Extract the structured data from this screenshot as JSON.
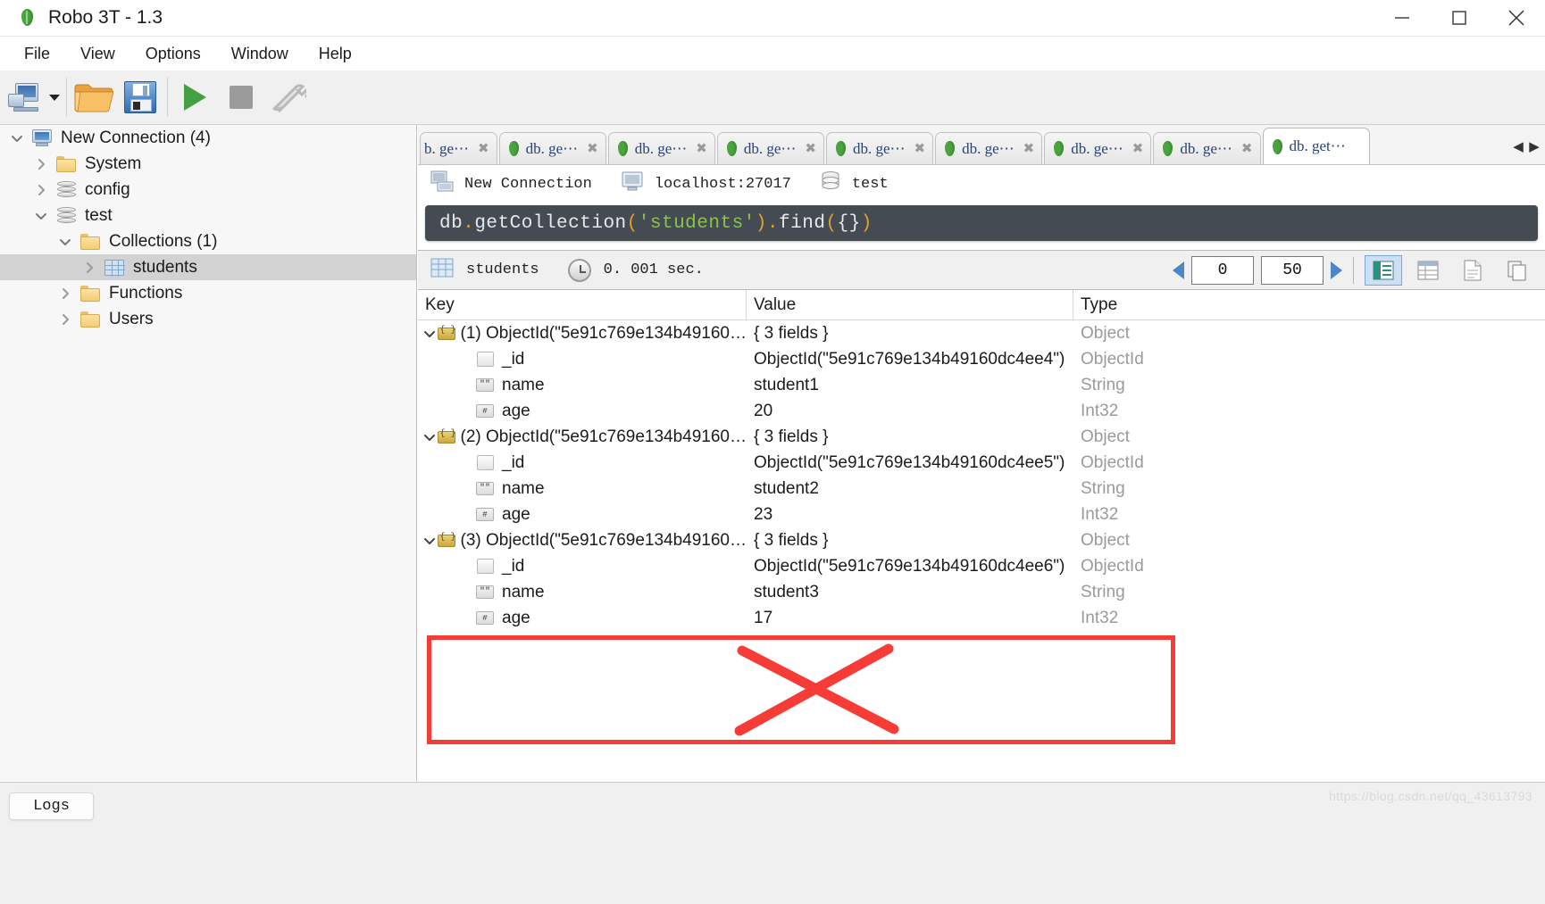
{
  "window": {
    "title": "Robo 3T - 1.3",
    "app_icon": "mongodb-leaf-icon",
    "controls": {
      "minimize": "minimize-icon",
      "maximize": "maximize-icon",
      "close": "close-icon"
    }
  },
  "menubar": {
    "items": [
      {
        "label": "File"
      },
      {
        "label": "View"
      },
      {
        "label": "Options"
      },
      {
        "label": "Window"
      },
      {
        "label": "Help"
      }
    ]
  },
  "toolbar": {
    "buttons": [
      {
        "name": "connect-button",
        "icon": "computer-connect-icon"
      },
      {
        "name": "connect-dropdown",
        "icon": "chevron-down-icon"
      },
      {
        "name": "open-script-button",
        "icon": "folder-open-icon"
      },
      {
        "name": "save-script-button",
        "icon": "floppy-save-icon"
      },
      {
        "name": "execute-button",
        "icon": "play-icon"
      },
      {
        "name": "stop-button",
        "icon": "stop-icon"
      },
      {
        "name": "explain-button",
        "icon": "wrench-icon"
      }
    ]
  },
  "sidebar": {
    "tree": [
      {
        "label": "New Connection (4)",
        "icon": "computer-icon",
        "depth": 0,
        "expanded": true,
        "has_twisty": true,
        "selected": false
      },
      {
        "label": "System",
        "icon": "folder-icon",
        "depth": 1,
        "expanded": false,
        "has_twisty": true,
        "selected": false
      },
      {
        "label": "config",
        "icon": "database-icon",
        "depth": 1,
        "expanded": false,
        "has_twisty": true,
        "selected": false
      },
      {
        "label": "test",
        "icon": "database-icon",
        "depth": 1,
        "expanded": true,
        "has_twisty": true,
        "selected": false
      },
      {
        "label": "Collections (1)",
        "icon": "folder-icon",
        "depth": 2,
        "expanded": true,
        "has_twisty": true,
        "selected": false
      },
      {
        "label": "students",
        "icon": "collection-grid-icon",
        "depth": 3,
        "expanded": false,
        "has_twisty": true,
        "selected": true
      },
      {
        "label": "Functions",
        "icon": "folder-icon",
        "depth": 2,
        "expanded": false,
        "has_twisty": true,
        "selected": false
      },
      {
        "label": "Users",
        "icon": "folder-icon",
        "depth": 2,
        "expanded": false,
        "has_twisty": true,
        "selected": false
      }
    ]
  },
  "tabs": {
    "items": [
      {
        "label": "b. ge⋯",
        "active": false,
        "partial": true
      },
      {
        "label": "db. ge⋯",
        "active": false,
        "partial": false
      },
      {
        "label": "db. ge⋯",
        "active": false,
        "partial": false
      },
      {
        "label": "db. ge⋯",
        "active": false,
        "partial": false
      },
      {
        "label": "db. ge⋯",
        "active": false,
        "partial": false
      },
      {
        "label": "db. ge⋯",
        "active": false,
        "partial": false
      },
      {
        "label": "db. ge⋯",
        "active": false,
        "partial": false
      },
      {
        "label": "db. ge⋯",
        "active": false,
        "partial": false
      },
      {
        "label": "db. get⋯",
        "active": true,
        "partial": false
      }
    ],
    "close_glyph": "✖",
    "nav_prev": "◀",
    "nav_next": "▶"
  },
  "connection_bar": {
    "connection_name": "New Connection",
    "host": "localhost:27017",
    "database": "test",
    "icons": {
      "connection": "server-icon",
      "host": "monitor-icon",
      "database": "database-icon"
    }
  },
  "query_editor": {
    "full_text": "db.getCollection('students').find({})",
    "tokens": [
      {
        "t": "db",
        "c": "w"
      },
      {
        "t": ".",
        "c": "o"
      },
      {
        "t": "getCollection",
        "c": "w"
      },
      {
        "t": "(",
        "c": "o"
      },
      {
        "t": "'students'",
        "c": "s"
      },
      {
        "t": ")",
        "c": "o"
      },
      {
        "t": ".",
        "c": "o"
      },
      {
        "t": "find",
        "c": "w"
      },
      {
        "t": "(",
        "c": "o"
      },
      {
        "t": "{}",
        "c": "w"
      },
      {
        "t": ")",
        "c": "o"
      }
    ]
  },
  "result_toolbar": {
    "collection_name": "students",
    "collection_icon": "collection-grid-icon",
    "clock_icon": "clock-icon",
    "elapsed": "0. 001 sec.",
    "skip_value": "0",
    "limit_value": "50",
    "prev_icon": "prev-page-icon",
    "next_icon": "next-page-icon",
    "view_modes": [
      {
        "name": "tree-view-button",
        "icon": "tree-view-icon",
        "active": true
      },
      {
        "name": "table-view-button",
        "icon": "table-view-icon",
        "active": false
      },
      {
        "name": "text-view-button",
        "icon": "text-view-icon",
        "active": false
      },
      {
        "name": "maximize-view-button",
        "icon": "copy-icon",
        "active": false
      }
    ]
  },
  "results": {
    "columns": [
      "Key",
      "Value",
      "Type"
    ],
    "rows": [
      {
        "key": "(1) ObjectId(\"5e91c769e134b49160…",
        "value": "{ 3 fields }",
        "type": "Object",
        "depth": 0,
        "icon": "object-icon",
        "twisty": "expanded"
      },
      {
        "key": "_id",
        "value": "ObjectId(\"5e91c769e134b49160dc4ee4\")",
        "type": "ObjectId",
        "depth": 1,
        "icon": "blank-field-icon",
        "twisty": "none"
      },
      {
        "key": "name",
        "value": "student1",
        "type": "String",
        "depth": 1,
        "icon": "string-icon",
        "twisty": "none"
      },
      {
        "key": "age",
        "value": "20",
        "type": "Int32",
        "depth": 1,
        "icon": "int-icon",
        "twisty": "none"
      },
      {
        "key": "(2) ObjectId(\"5e91c769e134b49160…",
        "value": "{ 3 fields }",
        "type": "Object",
        "depth": 0,
        "icon": "object-icon",
        "twisty": "expanded"
      },
      {
        "key": "_id",
        "value": "ObjectId(\"5e91c769e134b49160dc4ee5\")",
        "type": "ObjectId",
        "depth": 1,
        "icon": "blank-field-icon",
        "twisty": "none"
      },
      {
        "key": "name",
        "value": "student2",
        "type": "String",
        "depth": 1,
        "icon": "string-icon",
        "twisty": "none"
      },
      {
        "key": "age",
        "value": "23",
        "type": "Int32",
        "depth": 1,
        "icon": "int-icon",
        "twisty": "none"
      },
      {
        "key": "(3) ObjectId(\"5e91c769e134b49160…",
        "value": "{ 3 fields }",
        "type": "Object",
        "depth": 0,
        "icon": "object-icon",
        "twisty": "expanded"
      },
      {
        "key": "_id",
        "value": "ObjectId(\"5e91c769e134b49160dc4ee6\")",
        "type": "ObjectId",
        "depth": 1,
        "icon": "blank-field-icon",
        "twisty": "none"
      },
      {
        "key": "name",
        "value": "student3",
        "type": "String",
        "depth": 1,
        "icon": "string-icon",
        "twisty": "none"
      },
      {
        "key": "age",
        "value": "17",
        "type": "Int32",
        "depth": 1,
        "icon": "int-icon",
        "twisty": "none"
      }
    ]
  },
  "annotation": {
    "type": "red-box-with-cross",
    "color": "#f73b37"
  },
  "statusbar": {
    "logs_label": "Logs"
  },
  "watermark": {
    "text": "https://blog.csdn.net/qq_43613793"
  }
}
